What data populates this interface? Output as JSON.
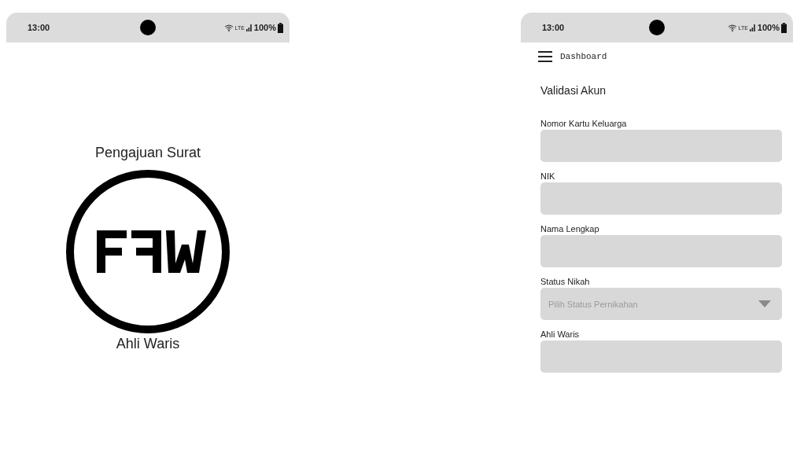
{
  "screens": [
    {
      "status_bar": {
        "time": "13:00",
        "network": "LTE",
        "battery": "100%"
      },
      "title": "Pengajuan Surat",
      "subtitle": "Ahli Waris"
    },
    {
      "status_bar": {
        "time": "13:00",
        "network": "LTE",
        "battery": "100%"
      },
      "app_bar": {
        "title": "Dashboard"
      },
      "heading": "Validasi Akun",
      "fields": [
        {
          "kind": "text",
          "label": "Nomor Kartu Keluarga"
        },
        {
          "kind": "text",
          "label": "NIK"
        },
        {
          "kind": "text",
          "label": "Nama Lengkap"
        },
        {
          "kind": "dropdown",
          "label": "Status Nikah",
          "placeholder": "Pilih Status Pernikahan"
        },
        {
          "kind": "text",
          "label": "Ahli Waris"
        }
      ]
    }
  ]
}
